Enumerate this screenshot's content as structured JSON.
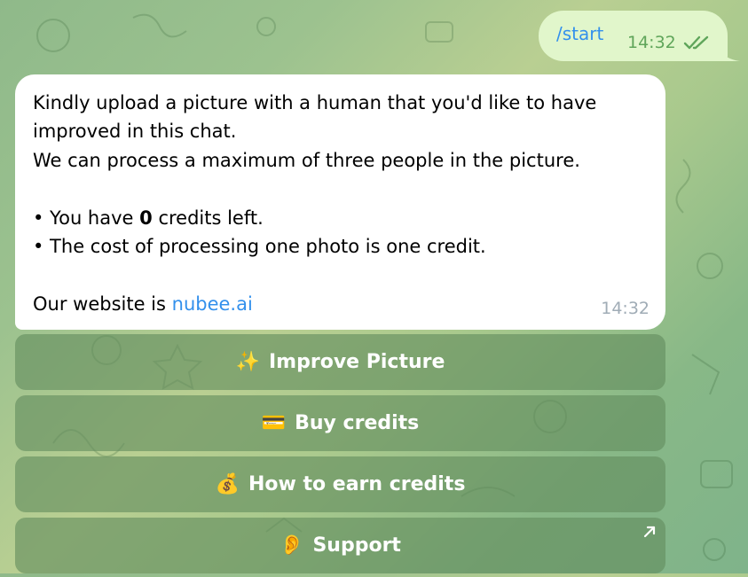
{
  "outgoing_message": {
    "text": "/start",
    "time": "14:32",
    "status_icon": "double-check-icon"
  },
  "incoming_message": {
    "line1": "Kindly upload a picture with a human that you'd like to have",
    "line2": "improved in this chat.",
    "line3": "We can process a maximum of three people in the picture.",
    "credits_prefix": "• You have ",
    "credits_value": "0",
    "credits_suffix": " credits left.",
    "cost_line": "• The cost of processing one photo is one credit.",
    "website_prefix": "Our website is ",
    "website_link": "nubee.ai",
    "time": "14:32"
  },
  "buttons": [
    {
      "icon": "✨",
      "icon_name": "sparkles-icon",
      "label": "Improve Picture"
    },
    {
      "icon": "💳",
      "icon_name": "credit-card-icon",
      "label": "Buy credits"
    },
    {
      "icon": "💰",
      "icon_name": "money-bag-icon",
      "label": "How to earn credits"
    },
    {
      "icon": "👂",
      "icon_name": "ear-icon",
      "label": "Support",
      "corner_icon": "external-arrow-icon"
    }
  ],
  "colors": {
    "outgoing_bubble": "#e1f6cb",
    "link": "#3390ec",
    "outgoing_time": "#5fa55a",
    "incoming_time": "#a0acb6"
  }
}
